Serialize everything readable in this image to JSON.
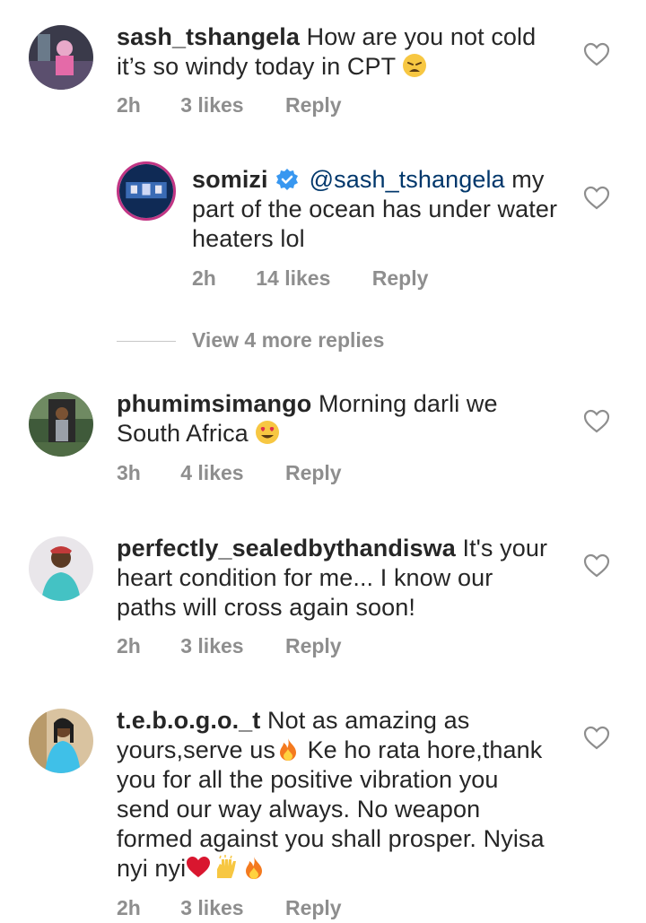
{
  "comments": [
    {
      "username": "sash_tshangela",
      "text": "How are you not cold it’s so windy today in CPT",
      "time": "2h",
      "likes": "3 likes",
      "reply_label": "Reply"
    },
    {
      "username": "somizi",
      "mention": "@sash_tshangela",
      "text": "my part of the ocean has under water heaters lol",
      "time": "2h",
      "likes": "14 likes",
      "reply_label": "Reply"
    },
    {
      "username": "phumimsimango",
      "text": "Morning darli we South Africa",
      "time": "3h",
      "likes": "4 likes",
      "reply_label": "Reply"
    },
    {
      "username": "perfectly_sealedbythandiswa",
      "text": "It's your heart condition for me... I know our paths will cross again soon!",
      "time": "2h",
      "likes": "3 likes",
      "reply_label": "Reply"
    },
    {
      "username": "t.e.b.o.g.o._t",
      "text_parts": [
        "Not as amazing as yours,serve us",
        " Ke ho rata hore,thank you for all the positive vibration you send our way always. No weapon formed against you shall prosper. Nyisa nyi nyi"
      ],
      "time": "2h",
      "likes": "3 likes",
      "reply_label": "Reply"
    }
  ],
  "view_more_replies": "View 4 more replies",
  "colors": {
    "text": "#262626",
    "meta": "#8e8e8e",
    "mention": "#00376b",
    "verified": "#3897f0"
  },
  "icons": [
    "heart-outline-icon",
    "verified-badge-icon",
    "weary-face-emoji",
    "heart-eyes-emoji",
    "fire-emoji",
    "red-heart-emoji",
    "raised-hands-emoji"
  ]
}
